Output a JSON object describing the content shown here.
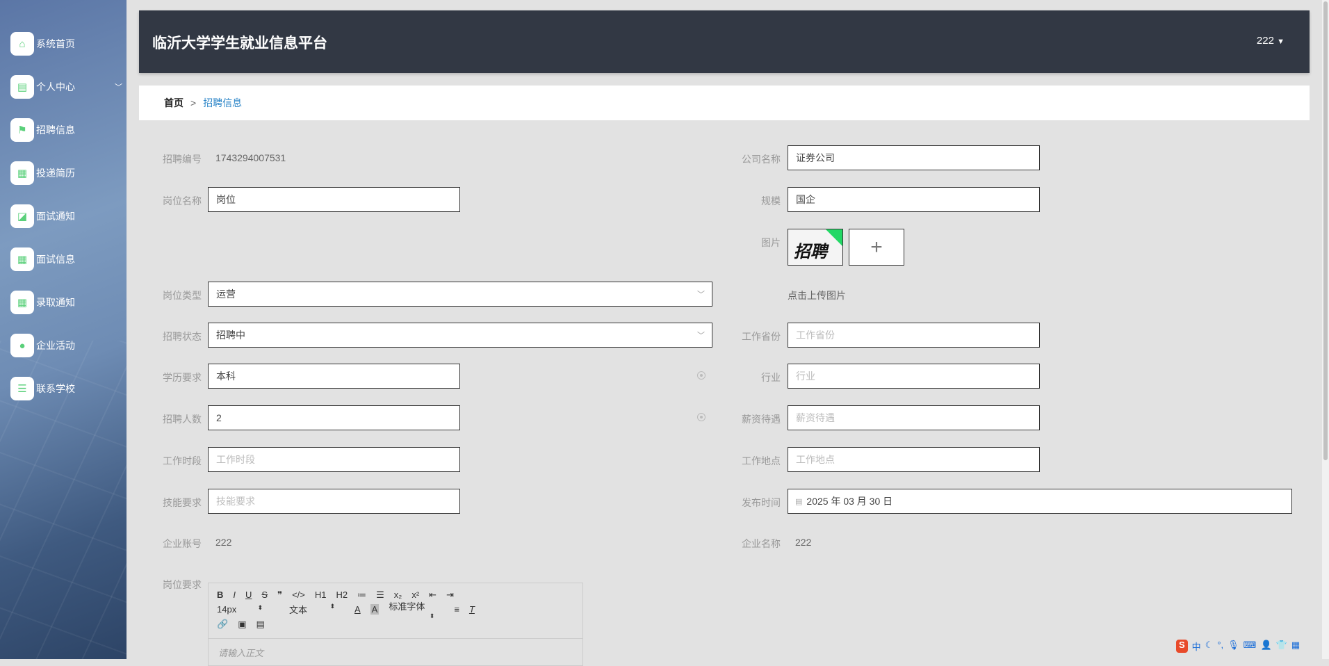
{
  "app": {
    "title": "临沂大学学生就业信息平台",
    "user": "222"
  },
  "sidebar": {
    "items": [
      {
        "label": "系统首页",
        "icon": "home-icon"
      },
      {
        "label": "个人中心",
        "icon": "id-card-icon",
        "expandable": true
      },
      {
        "label": "招聘信息",
        "icon": "flag-icon"
      },
      {
        "label": "投递简历",
        "icon": "grid-icon"
      },
      {
        "label": "面试通知",
        "icon": "chart-icon"
      },
      {
        "label": "面试信息",
        "icon": "grid-icon"
      },
      {
        "label": "录取通知",
        "icon": "grid-icon"
      },
      {
        "label": "企业活动",
        "icon": "balloon-icon"
      },
      {
        "label": "联系学校",
        "icon": "sliders-icon"
      }
    ]
  },
  "breadcrumb": {
    "home": "首页",
    "sep": ">",
    "current": "招聘信息"
  },
  "form": {
    "job_no": {
      "label": "招聘编号",
      "value": "1743294007531"
    },
    "company": {
      "label": "公司名称",
      "value": "证券公司"
    },
    "position": {
      "label": "岗位名称",
      "value": "岗位"
    },
    "scale": {
      "label": "规模",
      "value": "国企"
    },
    "image": {
      "label": "图片",
      "thumb_text": "招聘",
      "hint": "点击上传图片",
      "add": "+"
    },
    "job_type": {
      "label": "岗位类型",
      "value": "运营"
    },
    "status": {
      "label": "招聘状态",
      "value": "招聘中"
    },
    "province": {
      "label": "工作省份",
      "placeholder": "工作省份"
    },
    "education": {
      "label": "学历要求",
      "value": "本科"
    },
    "industry": {
      "label": "行业",
      "placeholder": "行业"
    },
    "headcount": {
      "label": "招聘人数",
      "value": "2"
    },
    "salary": {
      "label": "薪资待遇",
      "placeholder": "薪资待遇"
    },
    "hours": {
      "label": "工作时段",
      "placeholder": "工作时段"
    },
    "location": {
      "label": "工作地点",
      "placeholder": "工作地点"
    },
    "skills": {
      "label": "技能要求",
      "placeholder": "技能要求"
    },
    "publish": {
      "label": "发布时间",
      "value": "2025 年 03 月 30 日"
    },
    "account": {
      "label": "企业账号",
      "value": "222"
    },
    "company_name": {
      "label": "企业名称",
      "value": "222"
    },
    "requirements": {
      "label": "岗位要求"
    }
  },
  "editor": {
    "font_size": "14px",
    "format": "文本",
    "font": "标准字体",
    "placeholder": "请输入正文",
    "row1": [
      "B",
      "I",
      "U",
      "S",
      "❞",
      "</>",
      "H1",
      "H2",
      "≔",
      "☰",
      "x₂",
      "x²",
      "⇤",
      "⇥"
    ]
  },
  "colors": {
    "header": "#323844",
    "accent": "#2d86c8",
    "icon": "#5ad07a"
  }
}
